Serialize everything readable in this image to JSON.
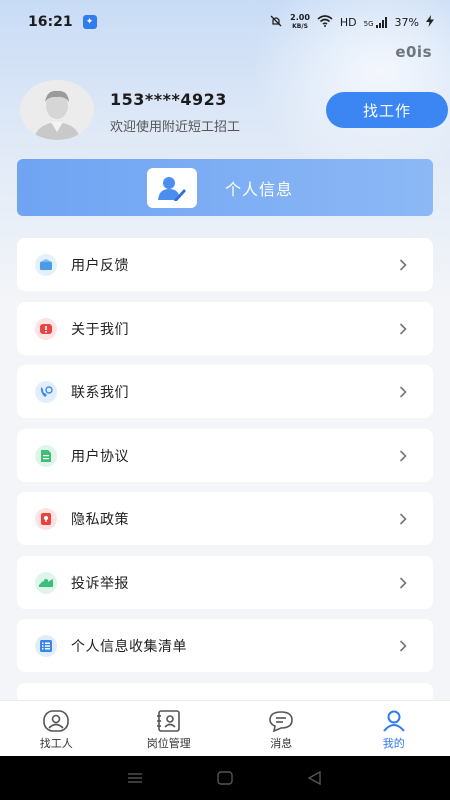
{
  "status_bar": {
    "time": "16:21",
    "speed_value": "2.00",
    "speed_unit": "KB/S",
    "network": "HD",
    "signal": "5G",
    "battery": "37%"
  },
  "watermark": "e0is",
  "profile": {
    "phone": "153****4923",
    "welcome": "欢迎使用附近短工招工",
    "find_job_label": "找工作"
  },
  "info_banner": {
    "label": "个人信息"
  },
  "menu": [
    {
      "label": "用户反馈",
      "icon": "feedback-icon",
      "color": "#4a9be8"
    },
    {
      "label": "关于我们",
      "icon": "info-icon",
      "color": "#e84444"
    },
    {
      "label": "联系我们",
      "icon": "phone-icon",
      "color": "#3c8ee8"
    },
    {
      "label": "用户协议",
      "icon": "document-icon",
      "color": "#3fbf74"
    },
    {
      "label": "隐私政策",
      "icon": "lock-icon",
      "color": "#e8443c"
    },
    {
      "label": "投诉举报",
      "icon": "complaint-icon",
      "color": "#3dbd7d"
    },
    {
      "label": "个人信息收集清单",
      "icon": "list-icon",
      "color": "#3a86e6"
    }
  ],
  "tabbar": [
    {
      "label": "找工人",
      "icon": "find-worker-icon",
      "active": false
    },
    {
      "label": "岗位管理",
      "icon": "job-management-icon",
      "active": false
    },
    {
      "label": "消息",
      "icon": "message-icon",
      "active": false
    },
    {
      "label": "我的",
      "icon": "profile-icon",
      "active": true
    }
  ],
  "colors": {
    "accent": "#2f7bf0",
    "banner": "#7aabf4"
  }
}
